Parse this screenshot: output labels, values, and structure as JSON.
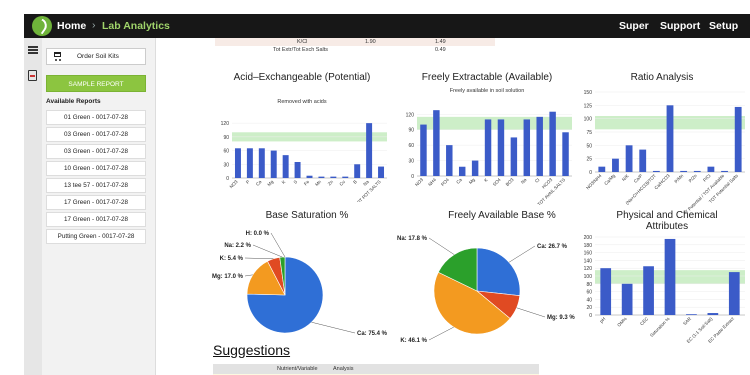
{
  "topbar": {
    "home_label": "Home",
    "separator": "›",
    "breadcrumb": "Lab Analytics",
    "nav": [
      "Super",
      "Support",
      "Setup"
    ]
  },
  "sidebar": {
    "order_label": "Order Soil Kits",
    "sample_label": "SAMPLE REPORT",
    "reports_title": "Available Reports",
    "reports": [
      "01 Green - 0017-07-28",
      "03 Green - 0017-07-28",
      "03 Green - 0017-07-28",
      "10 Green - 0017-07-28",
      "13 tee 57 - 0017-07-28",
      "17 Green - 0017-07-28",
      "17 Green - 0017-07-28",
      "Putting Green - 0017-07-28"
    ]
  },
  "ratio_table": [
    {
      "label": "K/Cl",
      "value1": "1.90",
      "value2": "1.49"
    },
    {
      "label": "Tot Extr/Tot Exch Salts",
      "value1": "",
      "value2": "0.49"
    }
  ],
  "colors": {
    "bar": "#3b5bc8",
    "band": "#cdeec8",
    "topbar": "#171717",
    "accent": "#8cc540"
  },
  "chart_data": [
    {
      "type": "bar",
      "title": "Acid–Exchangeable (Potential)",
      "subtitle": "Removed with acids",
      "ylim": [
        0,
        140
      ],
      "yticks": [
        0,
        30,
        60,
        90,
        120
      ],
      "band": [
        80,
        100
      ],
      "categories": [
        "NO3",
        "P",
        "Ca",
        "Mg",
        "K",
        "S",
        "Fe",
        "Mn",
        "Zn",
        "Cu",
        "B",
        "Na",
        "TOT POT SALTS"
      ],
      "values": [
        65,
        65,
        65,
        60,
        50,
        35,
        5,
        3,
        3,
        3,
        30,
        120,
        25
      ]
    },
    {
      "type": "bar",
      "title": "Freely Extractable (Available)",
      "subtitle": "Freely available in soil solution",
      "ylim": [
        0,
        140
      ],
      "yticks": [
        0,
        30,
        60,
        90,
        120
      ],
      "band": [
        90,
        115
      ],
      "categories": [
        "NO3",
        "NH4",
        "PO4",
        "Ca",
        "Mg",
        "K",
        "SO4",
        "BO3",
        "Na",
        "Cl",
        "HCO3",
        "TOT AVAIL SALTS"
      ],
      "values": [
        100,
        128,
        60,
        18,
        30,
        110,
        110,
        75,
        110,
        115,
        125,
        85
      ]
    },
    {
      "type": "bar",
      "title": "Ratio Analysis",
      "subtitle": "",
      "ylim": [
        0,
        150
      ],
      "yticks": [
        0,
        25,
        50,
        75,
        100,
        125,
        150
      ],
      "band": [
        80,
        105
      ],
      "categories": [
        "NO3/NH4",
        "Ca/Mg",
        "N/K",
        "Ca/P",
        "(Na+Cl+HCO3)/TOT",
        "Ca/HCO3",
        "P/Mn",
        "P/Zn",
        "P/Cl",
        "TOT Potential / TOT Available",
        "TOT Potential Salts"
      ],
      "values": [
        10,
        25,
        50,
        42,
        2,
        125,
        2,
        2,
        10,
        2,
        122
      ]
    },
    {
      "type": "pie",
      "title": "Base Saturation %",
      "slices": [
        {
          "label": "Ca: 75.4 %",
          "value": 75.4,
          "color": "#2f6fd6"
        },
        {
          "label": "Mg: 17.0 %",
          "value": 17.0,
          "color": "#f39a20"
        },
        {
          "label": "K: 5.4 %",
          "value": 5.4,
          "color": "#e04a22"
        },
        {
          "label": "Na: 2.2 %",
          "value": 2.2,
          "color": "#2ba02b"
        },
        {
          "label": "H: 0.0 %",
          "value": 0.0,
          "color": "#8e44ad"
        }
      ]
    },
    {
      "type": "pie",
      "title": "Freely Available Base %",
      "slices": [
        {
          "label": "Ca: 26.7 %",
          "value": 26.7,
          "color": "#2f6fd6"
        },
        {
          "label": "Mg: 9.3 %",
          "value": 9.3,
          "color": "#e04a22"
        },
        {
          "label": "K: 46.1 %",
          "value": 46.1,
          "color": "#f39a20"
        },
        {
          "label": "Na: 17.8 %",
          "value": 17.8,
          "color": "#2ba02b"
        }
      ]
    },
    {
      "type": "bar",
      "title": "Physical and Chemical Attributes",
      "subtitle": "",
      "ylim": [
        0,
        200
      ],
      "yticks": [
        0,
        20,
        40,
        60,
        80,
        100,
        120,
        140,
        160,
        180,
        200
      ],
      "band": [
        80,
        115
      ],
      "categories": [
        "pH",
        "OM%",
        "CEC",
        "Saturation %",
        "SAR",
        "EC (1:1 Soil:Salt)",
        "EC Paste Extract"
      ],
      "values": [
        120,
        80,
        125,
        195,
        2,
        5,
        110
      ]
    }
  ],
  "suggestions": {
    "title": "Suggestions",
    "col1": "Nutrient/Variable",
    "col2": "Analysis"
  }
}
